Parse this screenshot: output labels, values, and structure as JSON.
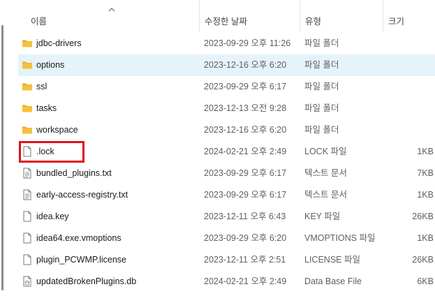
{
  "columns": {
    "name": "이름",
    "date": "수정한 날짜",
    "type": "유형",
    "size": "크기"
  },
  "rows": [
    {
      "name": "jdbc-drivers",
      "date": "2023-09-29 오후 11:26",
      "type": "파일 폴더",
      "size": "",
      "icon": "folder-icon"
    },
    {
      "name": "options",
      "date": "2023-12-16 오후 6:20",
      "type": "파일 폴더",
      "size": "",
      "icon": "folder-icon"
    },
    {
      "name": "ssl",
      "date": "2023-09-29 오후 6:17",
      "type": "파일 폴더",
      "size": "",
      "icon": "folder-icon"
    },
    {
      "name": "tasks",
      "date": "2023-12-13 오전 9:28",
      "type": "파일 폴더",
      "size": "",
      "icon": "folder-icon"
    },
    {
      "name": "workspace",
      "date": "2023-12-16 오후 6:20",
      "type": "파일 폴더",
      "size": "",
      "icon": "folder-icon"
    },
    {
      "name": ".lock",
      "date": "2024-02-21 오후 2:49",
      "type": "LOCK 파일",
      "size": "1KB",
      "icon": "file-icon"
    },
    {
      "name": "bundled_plugins.txt",
      "date": "2023-09-29 오후 6:17",
      "type": "텍스트 문서",
      "size": "7KB",
      "icon": "text-file-icon"
    },
    {
      "name": "early-access-registry.txt",
      "date": "2023-09-29 오후 6:17",
      "type": "텍스트 문서",
      "size": "1KB",
      "icon": "text-file-icon"
    },
    {
      "name": "idea.key",
      "date": "2023-12-11 오후 6:43",
      "type": "KEY 파일",
      "size": "26KB",
      "icon": "file-icon"
    },
    {
      "name": "idea64.exe.vmoptions",
      "date": "2023-09-29 오후 6:20",
      "type": "VMOPTIONS 파일",
      "size": "1KB",
      "icon": "file-icon"
    },
    {
      "name": "plugin_PCWMP.license",
      "date": "2023-12-11 오후 2:51",
      "type": "LICENSE 파일",
      "size": "26KB",
      "icon": "file-icon"
    },
    {
      "name": "updatedBrokenPlugins.db",
      "date": "2024-02-21 오후 2:49",
      "type": "Data Base File",
      "size": "6KB",
      "icon": "database-file-icon"
    }
  ],
  "colors": {
    "folder": "#f4c23e",
    "selected_row": "#e5f3fb",
    "highlight_box": "#e0111b"
  }
}
